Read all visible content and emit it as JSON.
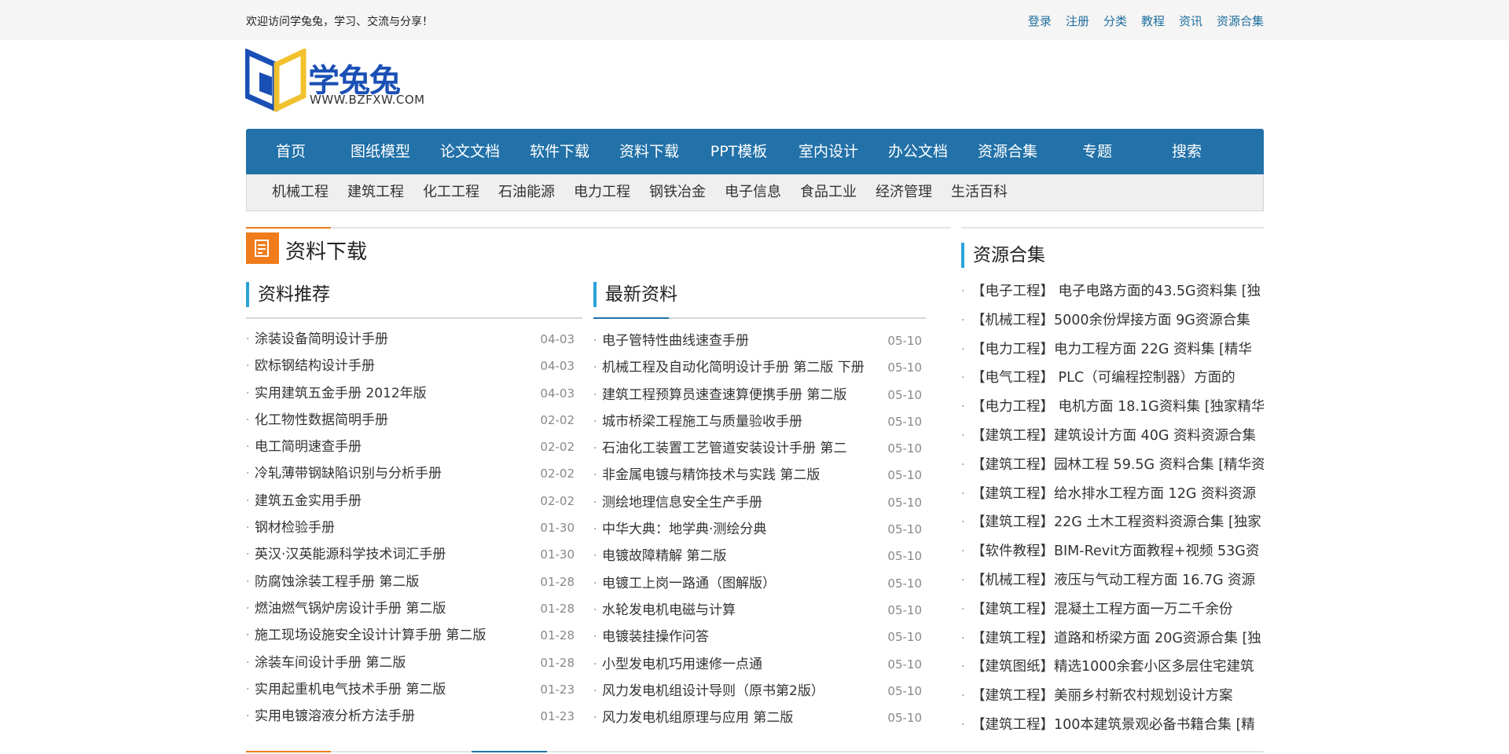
{
  "topbar": {
    "welcome": "欢迎访问学兔兔，学习、交流与分享！",
    "links": [
      "登录",
      "注册",
      "分类",
      "教程",
      "资讯",
      "资源合集"
    ]
  },
  "logo": {
    "brand": "学兔兔",
    "site": "WWW.BZFXW.COM"
  },
  "nav": {
    "items": [
      "首页",
      "图纸模型",
      "论文文档",
      "软件下载",
      "资料下载",
      "PPT模板",
      "室内设计",
      "办公文档",
      "资源合集",
      "专题",
      "搜索"
    ]
  },
  "subnav": {
    "items": [
      "机械工程",
      "建筑工程",
      "化工工程",
      "石油能源",
      "电力工程",
      "钢铁冶金",
      "电子信息",
      "食品工业",
      "经济管理",
      "生活百科"
    ]
  },
  "section": {
    "title": "资料下载"
  },
  "recommend": {
    "title": "资料推荐",
    "items": [
      {
        "title": "涂装设备简明设计手册",
        "date": "04-03"
      },
      {
        "title": "欧标钢结构设计手册",
        "date": "04-03"
      },
      {
        "title": "实用建筑五金手册 2012年版",
        "date": "04-03"
      },
      {
        "title": "化工物性数据简明手册",
        "date": "02-02"
      },
      {
        "title": "电工简明速查手册",
        "date": "02-02"
      },
      {
        "title": "冷轧薄带钢缺陷识别与分析手册",
        "date": "02-02"
      },
      {
        "title": "建筑五金实用手册",
        "date": "02-02"
      },
      {
        "title": "钢材检验手册",
        "date": "01-30"
      },
      {
        "title": "英汉·汉英能源科学技术词汇手册",
        "date": "01-30"
      },
      {
        "title": "防腐蚀涂装工程手册 第二版",
        "date": "01-28"
      },
      {
        "title": "燃油燃气锅炉房设计手册 第二版",
        "date": "01-28"
      },
      {
        "title": "施工现场设施安全设计计算手册 第二版",
        "date": "01-28"
      },
      {
        "title": "涂装车间设计手册 第二版",
        "date": "01-28"
      },
      {
        "title": "实用起重机电气技术手册 第二版",
        "date": "01-23"
      },
      {
        "title": "实用电镀溶液分析方法手册",
        "date": "01-23"
      }
    ]
  },
  "latest": {
    "title": "最新资料",
    "items": [
      {
        "title": "电子管特性曲线速查手册",
        "date": "05-10"
      },
      {
        "title": "机械工程及自动化简明设计手册 第二版 下册",
        "date": "05-10"
      },
      {
        "title": "建筑工程预算员速查速算便携手册 第二版",
        "date": "05-10"
      },
      {
        "title": "城市桥梁工程施工与质量验收手册",
        "date": "05-10"
      },
      {
        "title": "石油化工装置工艺管道安装设计手册 第二",
        "date": "05-10"
      },
      {
        "title": "非金属电镀与精饰技术与实践 第二版",
        "date": "05-10"
      },
      {
        "title": "测绘地理信息安全生产手册",
        "date": "05-10"
      },
      {
        "title": "中华大典：地学典·测绘分典",
        "date": "05-10"
      },
      {
        "title": "电镀故障精解 第二版",
        "date": "05-10"
      },
      {
        "title": "电镀工上岗一路通（图解版）",
        "date": "05-10"
      },
      {
        "title": "水轮发电机电磁与计算",
        "date": "05-10"
      },
      {
        "title": "电镀装挂操作问答",
        "date": "05-10"
      },
      {
        "title": "小型发电机巧用速修一点通",
        "date": "05-10"
      },
      {
        "title": "风力发电机组设计导则（原书第2版）",
        "date": "05-10"
      },
      {
        "title": "风力发电机组原理与应用 第二版",
        "date": "05-10"
      }
    ]
  },
  "resources": {
    "title": "资源合集",
    "items": [
      "【电子工程】 电子电路方面的43.5G资料集 [独",
      "【机械工程】5000余份焊接方面 9G资源合集",
      "【电力工程】电力工程方面 22G 资料集 [精华",
      "【电气工程】 PLC（可编程控制器）方面的",
      "【电力工程】 电机方面 18.1G资料集 [独家精华",
      "【建筑工程】建筑设计方面 40G 资料资源合集",
      "【建筑工程】园林工程 59.5G 资料合集 [精华资",
      "【建筑工程】给水排水工程方面 12G 资料资源",
      "【建筑工程】22G 土木工程资料资源合集 [独家",
      "【软件教程】BIM-Revit方面教程+视频 53G资",
      "【机械工程】液压与气动工程方面 16.7G 资源",
      "【建筑工程】混凝土工程方面一万二千余份",
      "【建筑工程】道路和桥梁方面 20G资源合集 [独",
      "【建筑图纸】精选1000余套小区多层住宅建筑",
      "【建筑工程】美丽乡村新农村规划设计方案",
      "【建筑工程】100本建筑景观必备书籍合集 [精"
    ]
  }
}
